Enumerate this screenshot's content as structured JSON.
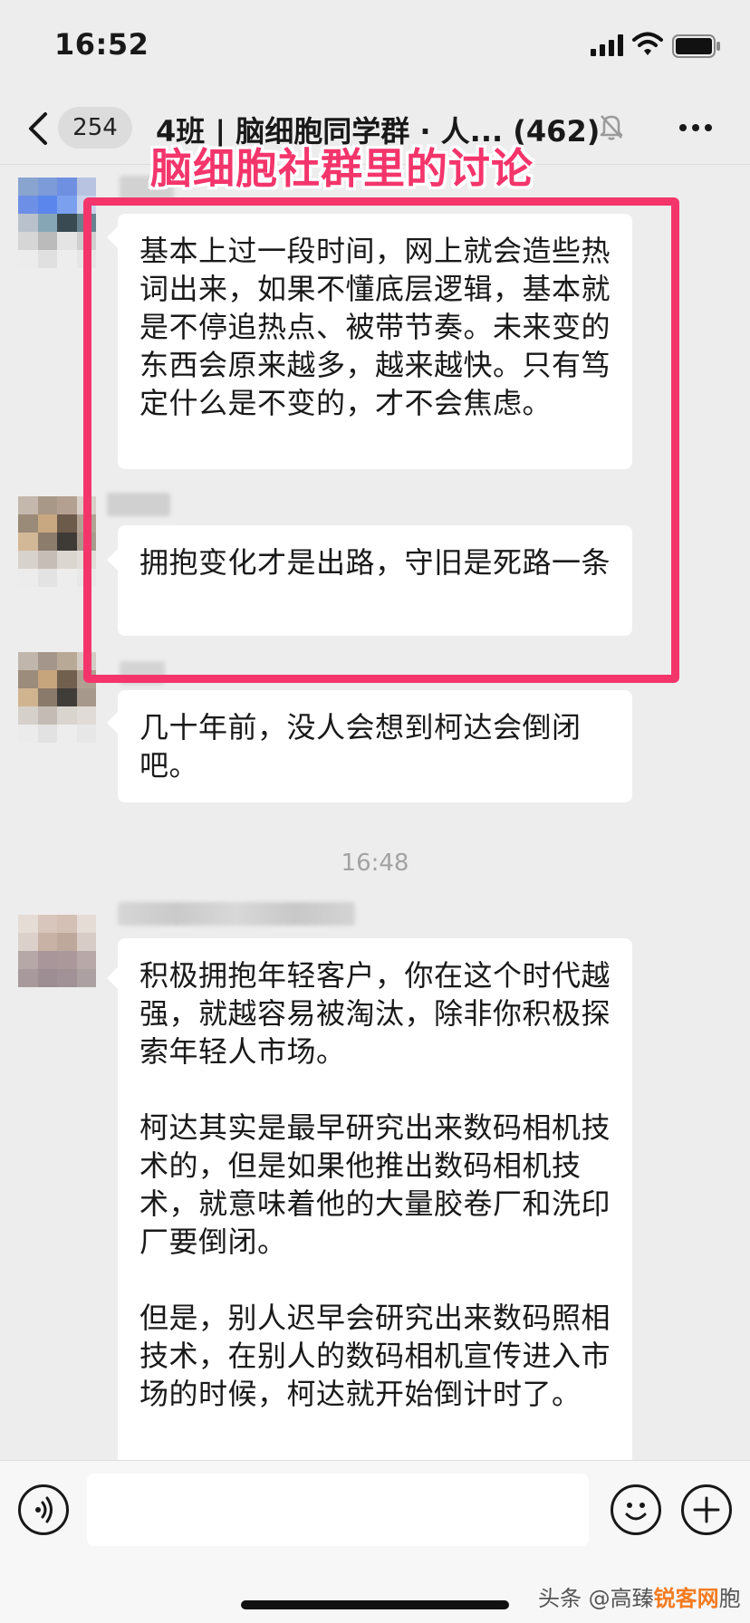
{
  "status_bar": {
    "time": "16:52"
  },
  "nav": {
    "unread_count": "254",
    "title": "4班 | 脑细胞同学群 · 人... (462)"
  },
  "annotation": {
    "label": "脑细胞社群里的讨论"
  },
  "messages": [
    {
      "text": "基本上过一段时间，网上就会造些热词出来，如果不懂底层逻辑，基本就是不停追热点、被带节奏。未来变的东西会原来越多，越来越快。只有笃定什么是不变的，才不会焦虑。"
    },
    {
      "text": "拥抱变化才是出路，守旧是死路一条"
    },
    {
      "text": "几十年前，没人会想到柯达会倒闭吧。"
    },
    {
      "paragraphs": [
        "积极拥抱年轻客户，你在这个时代越强，就越容易被淘汰，除非你积极探索年轻人市场。",
        "柯达其实是最早研究出来数码相机技术的，但是如果他推出数码相机技术，就意味着他的大量胶卷厂和洗印厂要倒闭。",
        "但是，别人迟早会研究出来数码照相技术，在别人的数码相机宣传进入市场的时候，柯达就开始倒计时了。"
      ]
    }
  ],
  "time_separator": "16:48",
  "watermark": {
    "prefix": "头条 @高臻",
    "brand": "锐客网",
    "suffix": "胞"
  },
  "colors": {
    "accent": "#f4356c",
    "bubble": "#ffffff",
    "background": "#ededed"
  }
}
